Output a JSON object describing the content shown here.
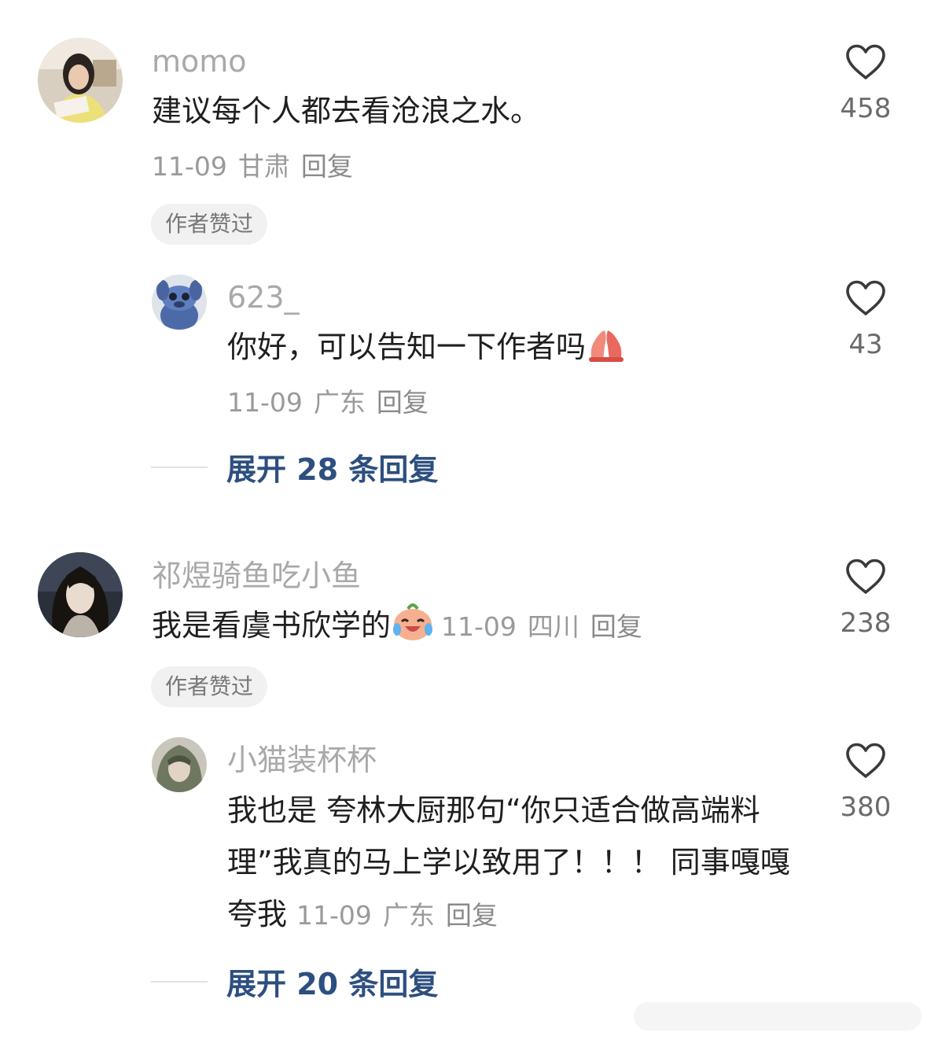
{
  "comments": [
    {
      "username": "momo",
      "text": "建议每个人都去看沧浪之水。",
      "date": "11-09",
      "location": "甘肃",
      "reply_label": "回复",
      "likes": "458",
      "badge": "作者赞过",
      "avatar_icon": "user-avatar",
      "replies": [
        {
          "username": "623_",
          "text": "你好，可以告知一下作者吗",
          "emoji": "pray-hands-emoji",
          "date": "11-09",
          "location": "广东",
          "reply_label": "回复",
          "likes": "43",
          "avatar_icon": "stitch-avatar"
        }
      ],
      "expand_label": "展开 28 条回复"
    },
    {
      "username": "祁煜骑鱼吃小鱼",
      "text": "我是看虞书欣学的",
      "emoji": "crying-laugh-emoji",
      "date": "11-09",
      "location": "四川",
      "reply_label": "回复",
      "likes": "238",
      "badge": "作者赞过",
      "avatar_icon": "anime-avatar",
      "replies": [
        {
          "username": "小猫装杯杯",
          "text": "我也是 夸林大厨那句“你只适合做高端料理”我真的马上学以致用了！！！ 同事嘎嘎夸我",
          "date": "11-09",
          "location": "广东",
          "reply_label": "回复",
          "likes": "380",
          "avatar_icon": "user-avatar"
        }
      ],
      "expand_label": "展开 20 条回复"
    }
  ],
  "colors": {
    "username": "#a9a9a9",
    "content": "#1f1f1f",
    "meta": "#9a9a9a",
    "expand": "#2d4f80",
    "badge_bg": "#f1f1f1"
  }
}
